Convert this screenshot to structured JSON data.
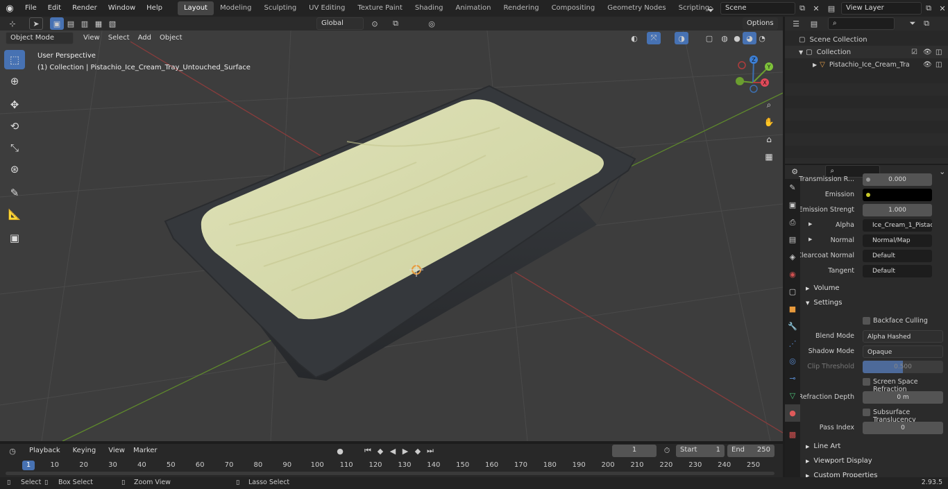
{
  "topbar": {
    "menus": [
      "File",
      "Edit",
      "Render",
      "Window",
      "Help"
    ],
    "tabs": [
      "Layout",
      "Modeling",
      "Sculpting",
      "UV Editing",
      "Texture Paint",
      "Shading",
      "Animation",
      "Rendering",
      "Compositing",
      "Geometry Nodes",
      "Scripting"
    ],
    "active_tab": "Layout",
    "scene": "Scene",
    "view_layer": "View Layer"
  },
  "viewport": {
    "mode": "Object Mode",
    "menus": [
      "View",
      "Select",
      "Add",
      "Object"
    ],
    "transform": "Global",
    "options": "Options",
    "overlay_title": "User Perspective",
    "overlay_subtitle": "(1) Collection | Pistachio_Ice_Cream_Tray_Untouched_Surface",
    "gizmo": {
      "x": "X",
      "y": "Y",
      "z": "Z"
    }
  },
  "outliner": {
    "scene_collection": "Scene Collection",
    "collection": "Collection",
    "object": "Pistachio_Ice_Cream_Tra"
  },
  "properties": {
    "transmission_label": "Transmission R...",
    "transmission_value": "0.000",
    "emission_label": "Emission",
    "emission_strength_label": "Emission Strengt",
    "emission_strength_value": "1.000",
    "alpha_label": "Alpha",
    "alpha_value": "Ice_Cream_1_Pistac...",
    "normal_label": "Normal",
    "normal_value": "Normal/Map",
    "clearcoat_label": "Clearcoat Normal",
    "clearcoat_value": "Default",
    "tangent_label": "Tangent",
    "tangent_value": "Default",
    "volume": "Volume",
    "settings": "Settings",
    "backface": "Backface Culling",
    "blend_label": "Blend Mode",
    "blend_value": "Alpha Hashed",
    "shadow_label": "Shadow Mode",
    "shadow_value": "Opaque",
    "clip_label": "Clip Threshold",
    "clip_value": "0.500",
    "ssr": "Screen Space Refraction",
    "refraction_label": "Refraction Depth",
    "refraction_value": "0 m",
    "subsurface": "Subsurface Translucency",
    "pass_label": "Pass Index",
    "pass_value": "0",
    "line_art": "Line Art",
    "viewport_display": "Viewport Display",
    "custom_props": "Custom Properties"
  },
  "timeline": {
    "menus": [
      "Playback",
      "Keying",
      "View",
      "Marker"
    ],
    "current_frame": "1",
    "start_label": "Start",
    "start": "1",
    "end_label": "End",
    "end": "250",
    "ticks": [
      "1",
      "10",
      "20",
      "30",
      "40",
      "50",
      "60",
      "70",
      "80",
      "90",
      "100",
      "110",
      "120",
      "130",
      "140",
      "150",
      "160",
      "170",
      "180",
      "190",
      "200",
      "210",
      "220",
      "230",
      "240",
      "250"
    ]
  },
  "statusbar": {
    "select": "Select",
    "box_select": "Box Select",
    "zoom_view": "Zoom View",
    "lasso_select": "Lasso Select",
    "version": "2.93.5"
  }
}
